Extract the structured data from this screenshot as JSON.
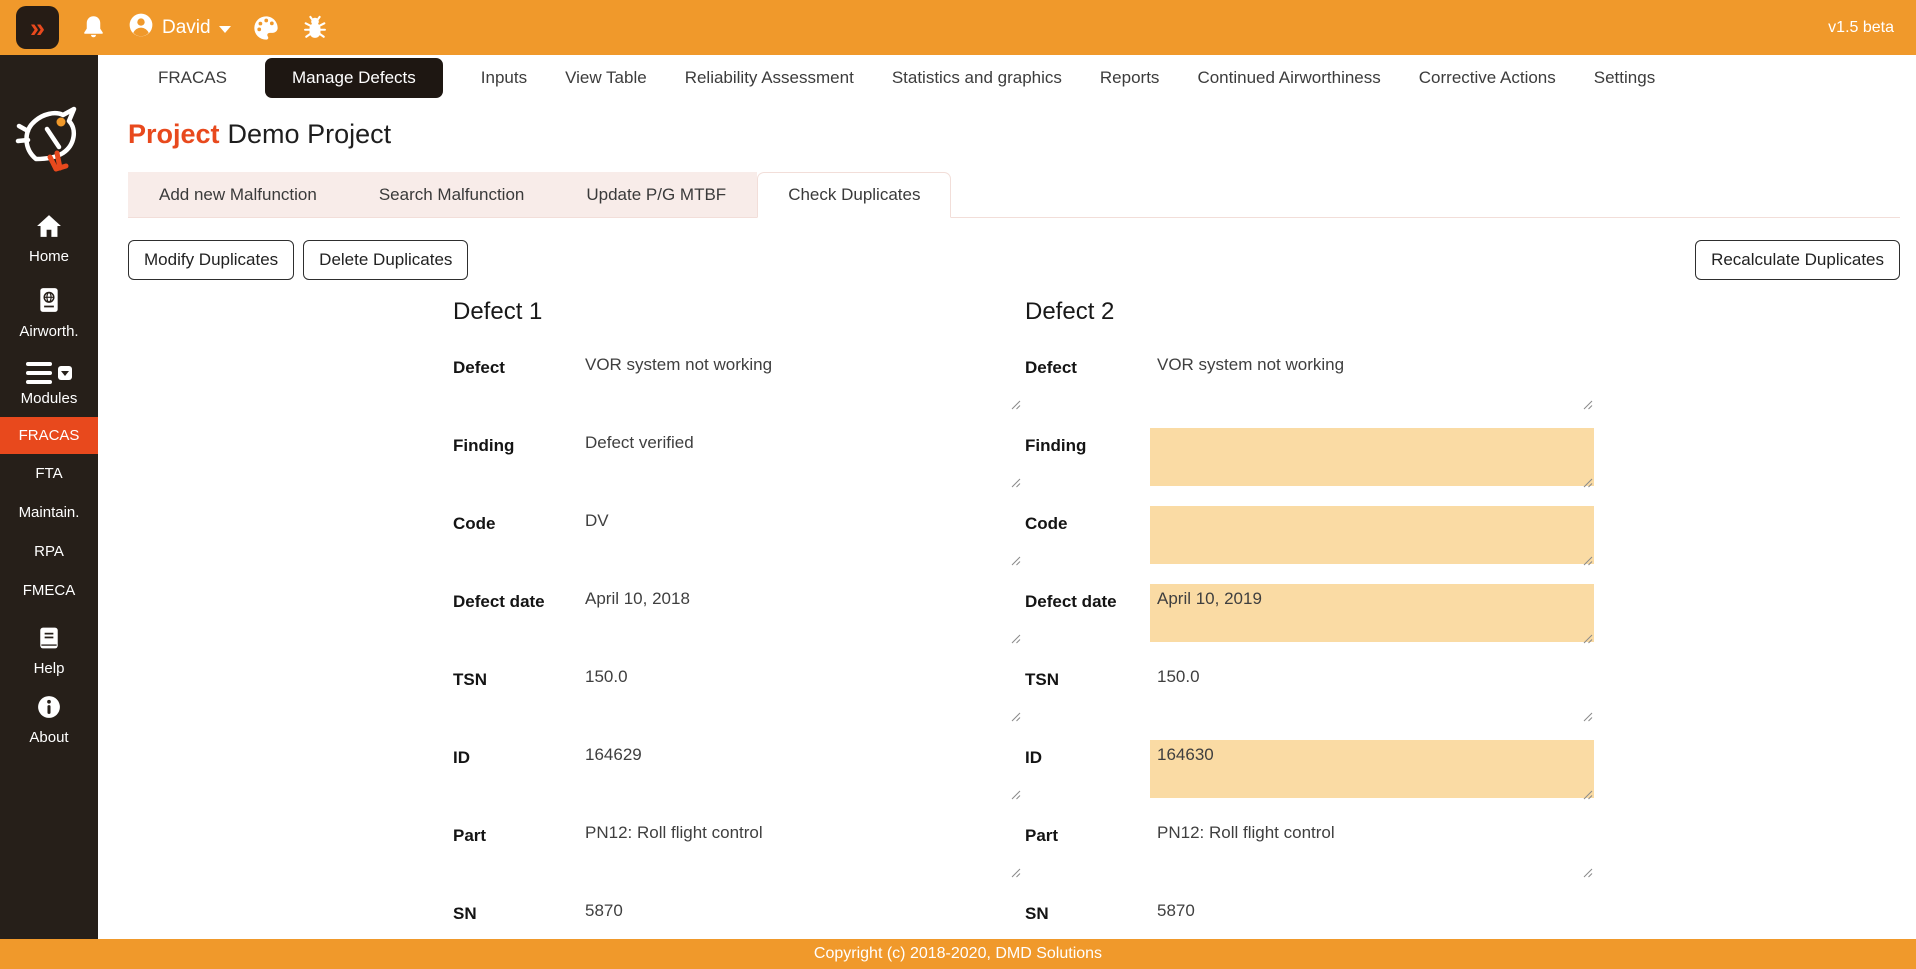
{
  "topbar": {
    "toggle_glyph": "»",
    "user_name": "David",
    "version": "v1.5 beta"
  },
  "sidebar": {
    "items": [
      {
        "label": "Home",
        "icon": "home-icon"
      },
      {
        "label": "Airworth.",
        "icon": "passport-icon"
      },
      {
        "label": "Modules",
        "icon": "menu-icon"
      },
      {
        "label": "FRACAS",
        "active": true
      },
      {
        "label": "FTA"
      },
      {
        "label": "Maintain."
      },
      {
        "label": "RPA"
      },
      {
        "label": "FMECA"
      },
      {
        "label": "Help",
        "icon": "book-icon"
      },
      {
        "label": "About",
        "icon": "info-icon"
      }
    ]
  },
  "nav": {
    "tabs": [
      {
        "label": "FRACAS"
      },
      {
        "label": "Manage Defects",
        "active": true
      },
      {
        "label": "Inputs"
      },
      {
        "label": "View Table"
      },
      {
        "label": "Reliability Assessment"
      },
      {
        "label": "Statistics and graphics"
      },
      {
        "label": "Reports"
      },
      {
        "label": "Continued Airworthiness"
      },
      {
        "label": "Corrective Actions"
      },
      {
        "label": "Settings"
      }
    ]
  },
  "page": {
    "title_prefix": "Project",
    "title_name": "Demo Project"
  },
  "subtabs": [
    {
      "label": "Add new Malfunction"
    },
    {
      "label": "Search Malfunction"
    },
    {
      "label": "Update P/G MTBF"
    },
    {
      "label": "Check Duplicates",
      "active": true
    }
  ],
  "toolbar": {
    "modify_label": "Modify Duplicates",
    "delete_label": "Delete Duplicates",
    "recalculate_label": "Recalculate Duplicates"
  },
  "comparison": {
    "defect1_title": "Defect 1",
    "defect2_title": "Defect 2",
    "rows": [
      {
        "label": "Defect",
        "value1": "VOR system not working",
        "value2": "VOR system not working",
        "highlight2": false
      },
      {
        "label": "Finding",
        "value1": "Defect verified",
        "value2": "",
        "highlight2": true
      },
      {
        "label": "Code",
        "value1": "DV",
        "value2": "",
        "highlight2": true
      },
      {
        "label": "Defect date",
        "value1": "April 10, 2018",
        "value2": "April 10, 2019",
        "highlight2": true
      },
      {
        "label": "TSN",
        "value1": "150.0",
        "value2": "150.0",
        "highlight2": false
      },
      {
        "label": "ID",
        "value1": "164629",
        "value2": "164630",
        "highlight2": true
      },
      {
        "label": "Part",
        "value1": "PN12: Roll flight control",
        "value2": "PN12: Roll flight control",
        "highlight2": false
      },
      {
        "label": "SN",
        "value1": "5870",
        "value2": "5870",
        "highlight2": false
      }
    ]
  },
  "footer": {
    "copyright": "Copyright (c) 2018-2020, DMD Solutions"
  },
  "colors": {
    "bar_orange": "#F0992B",
    "accent_red_orange": "#E8491D",
    "sidebar_dark": "#261F19",
    "highlight_peach": "#FADBA4",
    "subtab_pink": "#F8ECE9"
  }
}
